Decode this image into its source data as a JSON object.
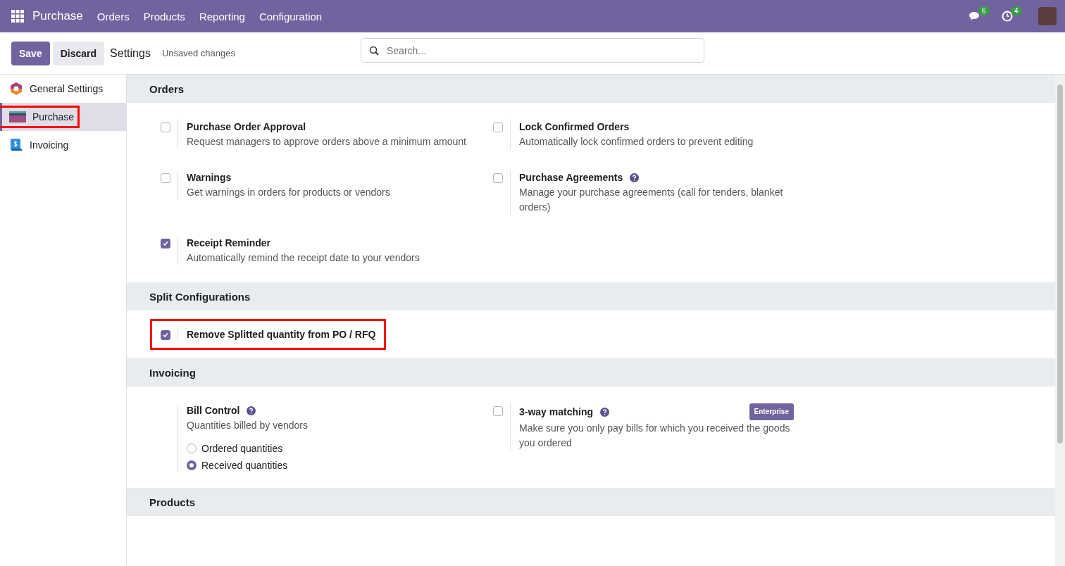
{
  "navbar": {
    "app_name": "Purchase",
    "menu": [
      "Orders",
      "Products",
      "Reporting",
      "Configuration"
    ],
    "messages_count": "6",
    "activities_count": "4"
  },
  "control_panel": {
    "save": "Save",
    "discard": "Discard",
    "title": "Settings",
    "status": "Unsaved changes",
    "search": {
      "placeholder": "Search..."
    }
  },
  "sidebar": {
    "items": [
      {
        "label": "General Settings",
        "selected": false,
        "highlighted": false
      },
      {
        "label": "Purchase",
        "selected": true,
        "highlighted": true
      },
      {
        "label": "Invoicing",
        "selected": false,
        "highlighted": false
      }
    ]
  },
  "sections": [
    {
      "title": "Orders",
      "settings": [
        {
          "kind": "checkbox",
          "title": "Purchase Order Approval",
          "description": "Request managers to approve orders above a minimum amount",
          "checked": false,
          "help": false,
          "highlighted": false
        },
        {
          "kind": "checkbox",
          "title": "Lock Confirmed Orders",
          "description": "Automatically lock confirmed orders to prevent editing",
          "checked": false,
          "help": false,
          "highlighted": false
        },
        {
          "kind": "checkbox",
          "title": "Warnings",
          "description": "Get warnings in orders for products or vendors",
          "checked": false,
          "help": false,
          "highlighted": false
        },
        {
          "kind": "checkbox",
          "title": "Purchase Agreements",
          "description": "Manage your purchase agreements (call for tenders, blanket orders)",
          "checked": false,
          "help": true,
          "highlighted": false
        },
        {
          "kind": "checkbox",
          "title": "Receipt Reminder",
          "description": "Automatically remind the receipt date to your vendors",
          "checked": true,
          "help": false,
          "highlighted": false
        }
      ]
    },
    {
      "title": "Split Configurations",
      "settings": [
        {
          "kind": "checkbox",
          "title": "Remove Splitted quantity from PO / RFQ",
          "checked": true,
          "help": false,
          "highlighted": true
        }
      ]
    },
    {
      "title": "Invoicing",
      "settings": [
        {
          "kind": "radio-group",
          "title": "Bill Control",
          "description": "Quantities billed by vendors",
          "help": true,
          "highlighted": false,
          "options": [
            {
              "label": "Ordered quantities",
              "selected": false
            },
            {
              "label": "Received quantities",
              "selected": true
            }
          ]
        },
        {
          "kind": "checkbox",
          "title": "3-way matching",
          "description": "Make sure you only pay bills for which you received the goods you ordered",
          "checked": false,
          "help": true,
          "badge": "Enterprise",
          "highlighted": false
        }
      ]
    },
    {
      "title": "Products"
    }
  ]
}
